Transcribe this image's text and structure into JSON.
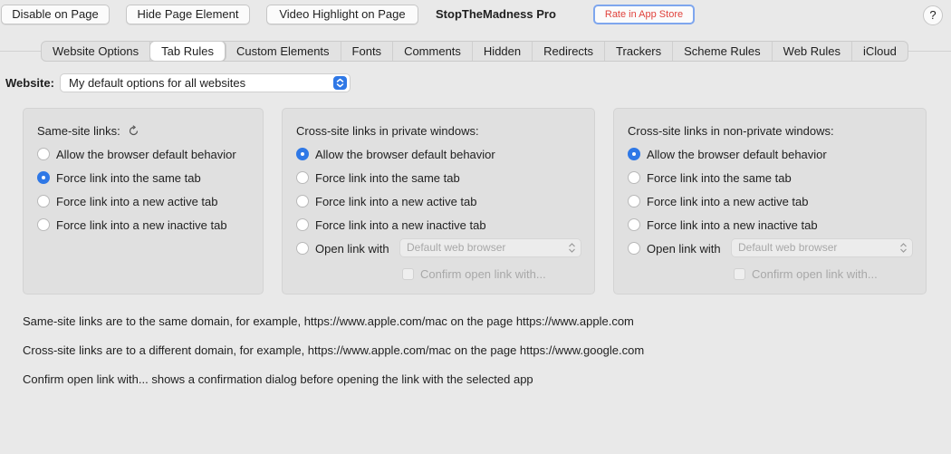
{
  "toolbar": {
    "disable_label": "Disable on Page",
    "hide_label": "Hide Page Element",
    "video_label": "Video Highlight on Page",
    "app_title": "StopTheMadness Pro",
    "rate_label": "Rate in App Store",
    "help_label": "?"
  },
  "tabs": [
    {
      "label": "Website Options"
    },
    {
      "label": "Tab Rules"
    },
    {
      "label": "Custom Elements"
    },
    {
      "label": "Fonts"
    },
    {
      "label": "Comments"
    },
    {
      "label": "Hidden"
    },
    {
      "label": "Redirects"
    },
    {
      "label": "Trackers"
    },
    {
      "label": "Scheme Rules"
    },
    {
      "label": "Web Rules"
    },
    {
      "label": "iCloud"
    }
  ],
  "active_tab": "Tab Rules",
  "website": {
    "label": "Website:",
    "selected": "My default options for all websites"
  },
  "panels": {
    "same_site": {
      "title": "Same-site links:",
      "options": [
        "Allow the browser default behavior",
        "Force link into the same tab",
        "Force link into a new active tab",
        "Force link into a new inactive tab"
      ],
      "selected_index": 1
    },
    "cross_private": {
      "title": "Cross-site links in private windows:",
      "options": [
        "Allow the browser default behavior",
        "Force link into the same tab",
        "Force link into a new active tab",
        "Force link into a new inactive tab",
        "Open link with"
      ],
      "selected_index": 0,
      "browser_select": "Default web browser",
      "confirm_label": "Confirm open link with..."
    },
    "cross_nonprivate": {
      "title": "Cross-site links in non-private windows:",
      "options": [
        "Allow the browser default behavior",
        "Force link into the same tab",
        "Force link into a new active tab",
        "Force link into a new inactive tab",
        "Open link with"
      ],
      "selected_index": 0,
      "browser_select": "Default web browser",
      "confirm_label": "Confirm open link with..."
    }
  },
  "notes": {
    "same_site": "Same-site links are to the same domain, for example, https://www.apple.com/mac on the page https://www.apple.com",
    "cross_site": "Cross-site links are to a different domain, for example, https://www.apple.com/mac on the page https://www.google.com",
    "confirm": "Confirm open link with... shows a confirmation dialog before opening the link with the selected app"
  },
  "colors": {
    "accent": "#2f78e6",
    "rate_text": "#e0423c",
    "background": "#e9e9e9"
  }
}
